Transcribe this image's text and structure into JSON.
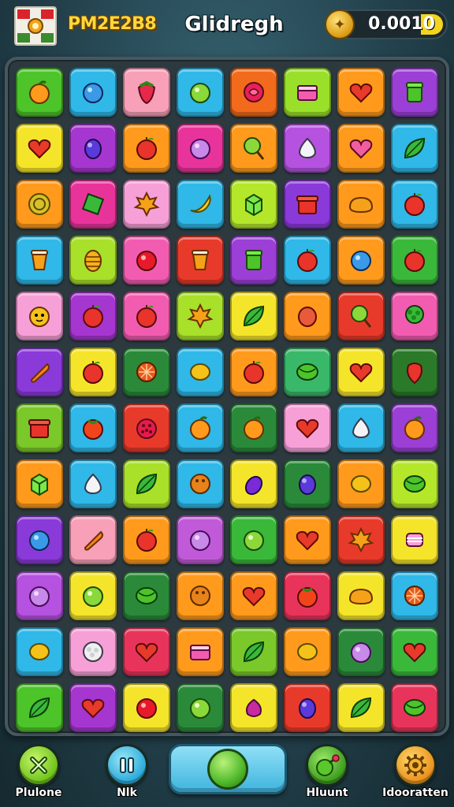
{
  "header": {
    "logo_icon": "crest-logo-icon",
    "player_name": "PM2E2B8",
    "title": "Glidregh",
    "coin_icon": "coin-icon",
    "coin_value": "0.0010"
  },
  "board": {
    "rows": 12,
    "cols": 8,
    "tiles": [
      [
        {
          "bg": "#4cc42a",
          "icon": "orange"
        },
        {
          "bg": "#2fb8e8",
          "icon": "blueberry"
        },
        {
          "bg": "#f7a0b8",
          "icon": "strawberry"
        },
        {
          "bg": "#2fb8e8",
          "icon": "lime"
        },
        {
          "bg": "#f26a1c",
          "icon": "rose"
        },
        {
          "bg": "#9ae02a",
          "icon": "cake"
        },
        {
          "bg": "#ff9a1c",
          "icon": "heart"
        },
        {
          "bg": "#9b3fd6",
          "icon": "jar"
        }
      ],
      [
        {
          "bg": "#f5e52a",
          "icon": "heart"
        },
        {
          "bg": "#a636d0",
          "icon": "plum"
        },
        {
          "bg": "#ff9a1c",
          "icon": "apple"
        },
        {
          "bg": "#e8349a",
          "icon": "grape"
        },
        {
          "bg": "#ff9a1c",
          "icon": "lollipop"
        },
        {
          "bg": "#b552e0",
          "icon": "garlic"
        },
        {
          "bg": "#ff9a1c",
          "icon": "berry"
        },
        {
          "bg": "#2fb8e8",
          "icon": "leaf"
        }
      ],
      [
        {
          "bg": "#ff9a1c",
          "icon": "coin"
        },
        {
          "bg": "#e8349a",
          "icon": "gem"
        },
        {
          "bg": "#f7a0d8",
          "icon": "maple"
        },
        {
          "bg": "#2fb8e8",
          "icon": "banana"
        },
        {
          "bg": "#b4e62a",
          "icon": "cube"
        },
        {
          "bg": "#8a3ad8",
          "icon": "box"
        },
        {
          "bg": "#ff9a1c",
          "icon": "bread"
        },
        {
          "bg": "#2fb8e8",
          "icon": "apple"
        }
      ],
      [
        {
          "bg": "#2fb8e8",
          "icon": "cup"
        },
        {
          "bg": "#a8e02a",
          "icon": "pinecone"
        },
        {
          "bg": "#f25cb0",
          "icon": "cherry"
        },
        {
          "bg": "#e83a2a",
          "icon": "cup"
        },
        {
          "bg": "#9b3fd6",
          "icon": "jar"
        },
        {
          "bg": "#2fb8e8",
          "icon": "apple"
        },
        {
          "bg": "#ff9a1c",
          "icon": "blueberry"
        },
        {
          "bg": "#3ab83a",
          "icon": "apple"
        }
      ],
      [
        {
          "bg": "#f7a0d8",
          "icon": "critter"
        },
        {
          "bg": "#a636d0",
          "icon": "apple"
        },
        {
          "bg": "#f25cb0",
          "icon": "apple"
        },
        {
          "bg": "#a8e02a",
          "icon": "maple"
        },
        {
          "bg": "#f5e52a",
          "icon": "leaf"
        },
        {
          "bg": "#ff9a1c",
          "icon": "mango"
        },
        {
          "bg": "#e83a2a",
          "icon": "lollipop"
        },
        {
          "bg": "#f25cb0",
          "icon": "broccoli"
        }
      ],
      [
        {
          "bg": "#8a3ad8",
          "icon": "carrot"
        },
        {
          "bg": "#f5e52a",
          "icon": "apple"
        },
        {
          "bg": "#2a8a3a",
          "icon": "citrus"
        },
        {
          "bg": "#2fb8e8",
          "icon": "lemon"
        },
        {
          "bg": "#ff9a1c",
          "icon": "apple"
        },
        {
          "bg": "#3ab86a",
          "icon": "melon"
        },
        {
          "bg": "#f5e52a",
          "icon": "heart"
        },
        {
          "bg": "#2a7a2a",
          "icon": "pepper"
        }
      ],
      [
        {
          "bg": "#7ac82a",
          "icon": "box"
        },
        {
          "bg": "#2fb8e8",
          "icon": "tomato"
        },
        {
          "bg": "#e83a2a",
          "icon": "raspberry"
        },
        {
          "bg": "#2fb8e8",
          "icon": "orange"
        },
        {
          "bg": "#2a8a3a",
          "icon": "orange"
        },
        {
          "bg": "#f7a0d8",
          "icon": "heart"
        },
        {
          "bg": "#2fb8e8",
          "icon": "garlic"
        },
        {
          "bg": "#9b3fd6",
          "icon": "orange"
        }
      ],
      [
        {
          "bg": "#ff9a1c",
          "icon": "cube"
        },
        {
          "bg": "#2fb8e8",
          "icon": "garlic"
        },
        {
          "bg": "#a8e02a",
          "icon": "leaf"
        },
        {
          "bg": "#2fb8e8",
          "icon": "coconut"
        },
        {
          "bg": "#f5e52a",
          "icon": "eggplant"
        },
        {
          "bg": "#2a8a3a",
          "icon": "plum"
        },
        {
          "bg": "#ff9a1c",
          "icon": "lemon"
        },
        {
          "bg": "#b4e62a",
          "icon": "melon"
        }
      ],
      [
        {
          "bg": "#8a3ad8",
          "icon": "blueberry"
        },
        {
          "bg": "#f7a0b8",
          "icon": "carrot"
        },
        {
          "bg": "#ff9a1c",
          "icon": "apple"
        },
        {
          "bg": "#c15ad8",
          "icon": "grape"
        },
        {
          "bg": "#3ab83a",
          "icon": "lime"
        },
        {
          "bg": "#ff9a1c",
          "icon": "heart"
        },
        {
          "bg": "#e83a2a",
          "icon": "maple"
        },
        {
          "bg": "#f5e52a",
          "icon": "candy"
        }
      ],
      [
        {
          "bg": "#b552e0",
          "icon": "grape"
        },
        {
          "bg": "#f5e52a",
          "icon": "lime"
        },
        {
          "bg": "#2a8a3a",
          "icon": "melon"
        },
        {
          "bg": "#ff9a1c",
          "icon": "coconut"
        },
        {
          "bg": "#ff9a1c",
          "icon": "heart"
        },
        {
          "bg": "#e8345a",
          "icon": "tomato"
        },
        {
          "bg": "#f5e52a",
          "icon": "bread"
        },
        {
          "bg": "#2fb8e8",
          "icon": "citrus"
        }
      ],
      [
        {
          "bg": "#2fb8e8",
          "icon": "lemon"
        },
        {
          "bg": "#f7a0d8",
          "icon": "cauliflower"
        },
        {
          "bg": "#e8345a",
          "icon": "heart"
        },
        {
          "bg": "#ff9a1c",
          "icon": "cake"
        },
        {
          "bg": "#7ac82a",
          "icon": "leaf"
        },
        {
          "bg": "#ff9a1c",
          "icon": "lemon"
        },
        {
          "bg": "#2a8a3a",
          "icon": "grape"
        },
        {
          "bg": "#3ab83a",
          "icon": "heart"
        }
      ],
      [
        {
          "bg": "#4cc42a",
          "icon": "leaf"
        },
        {
          "bg": "#a636d0",
          "icon": "heart"
        },
        {
          "bg": "#f5e52a",
          "icon": "cherry"
        },
        {
          "bg": "#2a8a3a",
          "icon": "lime"
        },
        {
          "bg": "#f5e52a",
          "icon": "radish"
        },
        {
          "bg": "#e83a2a",
          "icon": "plum"
        },
        {
          "bg": "#f5e52a",
          "icon": "leaf"
        },
        {
          "bg": "#e8345a",
          "icon": "melon"
        }
      ]
    ]
  },
  "footer": {
    "buttons": [
      {
        "label": "Plulone",
        "icon": "close-icon",
        "color": "#8fdc2a"
      },
      {
        "label": "Nlk",
        "icon": "pause-icon",
        "color": "#3cb8e0"
      },
      {
        "label": "",
        "icon": "green-orb-icon",
        "color": "#4fb82a"
      },
      {
        "label": "Hluunt",
        "icon": "hint-icon",
        "color": "#4fb82a"
      },
      {
        "label": "Idooratten",
        "icon": "gear-icon",
        "color": "#f3a51a"
      }
    ]
  }
}
